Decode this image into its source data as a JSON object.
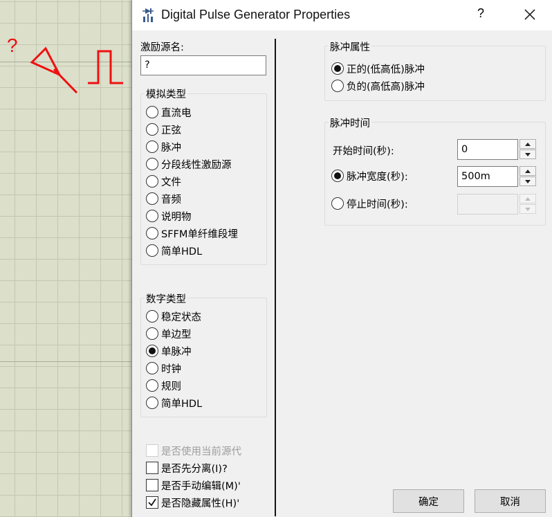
{
  "canvas": {
    "symbol_label": "?",
    "line_color": "#ee1111"
  },
  "dialog": {
    "title": "Digital Pulse Generator Properties",
    "help": "?",
    "close_icon": "close-icon",
    "source_name_label": "激励源名:",
    "source_name_value": "?",
    "analog_group": {
      "label": "模拟类型",
      "options": [
        "直流电",
        "正弦",
        "脉冲",
        "分段线性激励源",
        "文件",
        "音频",
        "说明物",
        "SFFM单纤维段埋",
        "简单HDL"
      ]
    },
    "digital_group": {
      "label": "数字类型",
      "options": [
        "稳定状态",
        "单边型",
        "单脉冲",
        "时钟",
        "规则",
        "简单HDL"
      ],
      "selected": "单脉冲"
    },
    "checkboxes": [
      {
        "label": "是否使用当前源代",
        "checked": false,
        "disabled": true
      },
      {
        "label": "是否先分离(I)?",
        "checked": false,
        "disabled": false
      },
      {
        "label": "是否手动编辑(M)'",
        "checked": false,
        "disabled": false
      },
      {
        "label": "是否隐藏属性(H)'",
        "checked": true,
        "disabled": false
      }
    ],
    "pulse_polarity": {
      "label": "脉冲属性",
      "options": [
        "正的(低高低)脉冲",
        "负的(高低高)脉冲"
      ],
      "selected": "正的(低高低)脉冲"
    },
    "pulse_timing": {
      "label": "脉冲时间",
      "start_label": "开始时间(秒):",
      "start_value": "0",
      "width_label": "脉冲宽度(秒):",
      "width_value": "500m",
      "stop_label": "停止时间(秒):",
      "stop_value": "",
      "selected": "脉冲宽度(秒):"
    },
    "ok_button": "确定",
    "cancel_button": "取消"
  }
}
